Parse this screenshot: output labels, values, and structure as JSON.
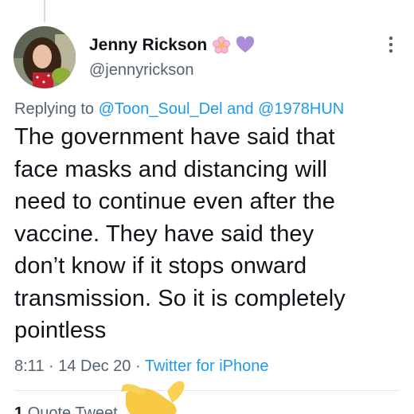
{
  "tweet": {
    "display_name": "Jenny Rickson",
    "emoji_icons": [
      "cherry-blossom-icon",
      "purple-heart-icon"
    ],
    "handle": "@jennyrickson",
    "replying_prefix": "Replying to",
    "replying_user_1": "@Toon_Soul_Del",
    "replying_and": "and",
    "replying_user_2": "@1978HUN",
    "text_lines": [
      "The government have said that",
      "face masks and distancing will",
      "need to continue even after the",
      "vaccine. They have said they",
      "don’t know if it stops onward",
      "transmission. So it is completely",
      "pointless"
    ],
    "time": "8:11",
    "date": "14 Dec 20",
    "source": "Twitter for iPhone",
    "separator": "·"
  },
  "stats": {
    "quote_count": "1",
    "quote_label": "Quote Tweet"
  },
  "colors": {
    "link": "#1d9bf0",
    "secondary_text": "#536471",
    "primary_text": "#0f1419"
  }
}
